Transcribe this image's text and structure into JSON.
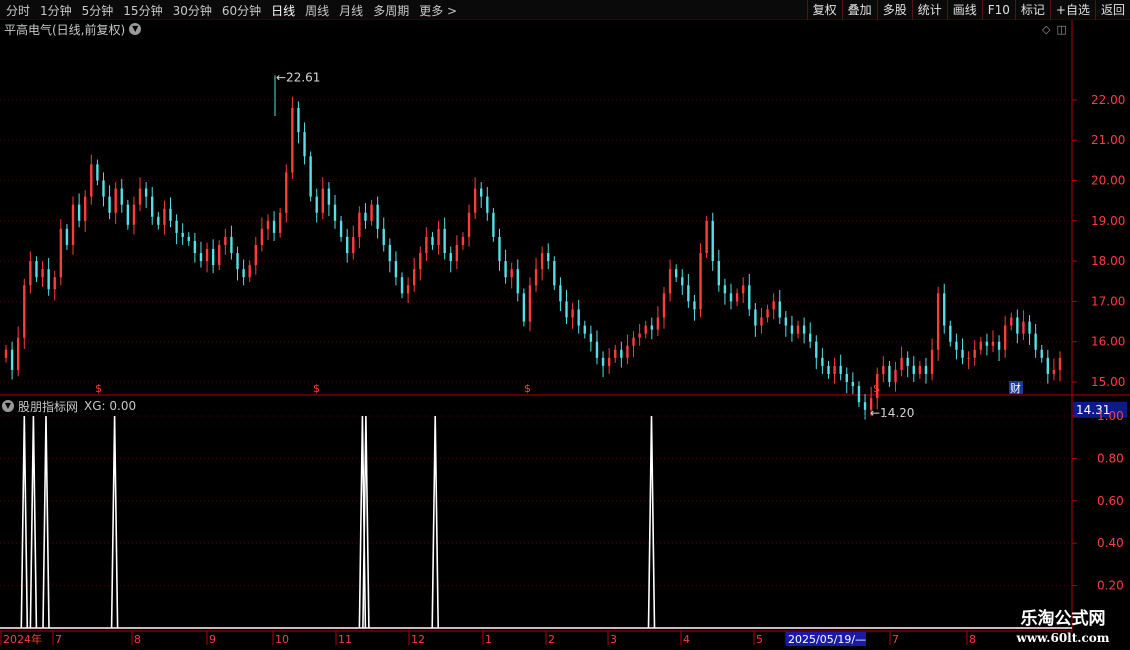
{
  "toolbar": {
    "periods": [
      "分时",
      "1分钟",
      "5分钟",
      "15分钟",
      "30分钟",
      "60分钟",
      "日线",
      "周线",
      "月线",
      "多周期",
      "更多 >"
    ],
    "active_period": "日线",
    "right_buttons": [
      "复权",
      "叠加",
      "多股",
      "统计",
      "画线",
      "F10",
      "标记",
      "+自选",
      "返回"
    ]
  },
  "price_panel": {
    "title": "平高电气(日线,前复权)",
    "high_label": "22.61",
    "low_label": "14.20",
    "current_price_label": "14.31",
    "y_ticks": [
      "22.00",
      "21.00",
      "20.00",
      "19.00",
      "18.00",
      "17.00",
      "16.00",
      "15.00"
    ],
    "dividend_marker": "$",
    "finance_marker": "财"
  },
  "indicator_panel": {
    "name": "股朋指标网",
    "value_text": "XG: 0.00",
    "y_ticks": [
      "1.00",
      "0.80",
      "0.60",
      "0.40",
      "0.20"
    ]
  },
  "time_axis": {
    "labels": [
      "2024年",
      "7",
      "8",
      "9",
      "10",
      "11",
      "12",
      "1",
      "2",
      "3",
      "4",
      "5",
      "2025/05/19/—",
      "7",
      "8"
    ],
    "highlight": "2025/05/19/—"
  },
  "watermark": {
    "line1": "乐淘公式网",
    "line2": "www.60lt.com"
  },
  "colors": {
    "up": "#ff3c3c",
    "down": "#54e0e6",
    "axis": "#b40000",
    "grid": "#5a0000",
    "signal": "#ffffff",
    "price_box": "#0c1a8a",
    "date_box": "#1a1aa8"
  },
  "chart_data": [
    {
      "type": "candlestick",
      "title": "平高电气(日线,前复权)",
      "ylim": [
        14.0,
        22.8
      ],
      "y_ticks": [
        15,
        16,
        17,
        18,
        19,
        20,
        21,
        22
      ],
      "x_range": [
        "2024-06",
        "2025-08"
      ],
      "key_points": [
        {
          "label": "start",
          "approx_close": 15.4
        },
        {
          "label": "2024-07 high",
          "approx_close": 20.4
        },
        {
          "label": "2024-10 peak",
          "value": 22.61
        },
        {
          "label": "2024-12 high",
          "approx_close": 19.8
        },
        {
          "label": "2025-02 low",
          "approx_close": 16.4
        },
        {
          "label": "2025-03 low",
          "approx_close": 15.5
        },
        {
          "label": "2025-04 high",
          "approx_close": 19.0
        },
        {
          "label": "2025-06 trough",
          "value": 14.2
        },
        {
          "label": "2025-07 high",
          "approx_close": 17.3
        },
        {
          "label": "last",
          "value": 14.31
        }
      ],
      "closes": [
        15.8,
        15.3,
        16.1,
        17.4,
        18.0,
        17.6,
        17.8,
        17.3,
        17.6,
        18.8,
        18.4,
        19.4,
        19.0,
        19.6,
        20.4,
        20.0,
        19.6,
        19.2,
        19.8,
        19.4,
        18.9,
        19.4,
        19.8,
        19.6,
        19.1,
        18.9,
        19.3,
        19.0,
        18.7,
        18.6,
        18.5,
        18.2,
        18.0,
        18.3,
        17.9,
        18.4,
        18.6,
        18.2,
        17.8,
        17.6,
        17.9,
        18.4,
        18.8,
        19.0,
        18.7,
        19.2,
        20.2,
        21.8,
        21.2,
        20.6,
        19.6,
        19.2,
        19.8,
        19.4,
        19.0,
        18.6,
        18.2,
        18.6,
        19.2,
        19.0,
        19.4,
        18.8,
        18.4,
        18.0,
        17.6,
        17.2,
        17.4,
        17.8,
        18.2,
        18.6,
        18.4,
        18.8,
        18.2,
        18.0,
        18.4,
        18.6,
        19.2,
        19.8,
        19.6,
        19.2,
        18.6,
        18.0,
        17.6,
        17.8,
        17.2,
        16.5,
        17.4,
        17.8,
        18.2,
        18.0,
        17.4,
        17.0,
        16.6,
        16.8,
        16.4,
        16.2,
        16.0,
        15.6,
        15.4,
        15.6,
        15.8,
        15.6,
        15.9,
        16.1,
        16.2,
        16.4,
        16.3,
        16.6,
        17.2,
        17.8,
        17.6,
        17.4,
        17.0,
        16.8,
        18.2,
        19.0,
        18.0,
        17.4,
        17.2,
        17.0,
        17.2,
        17.4,
        16.8,
        16.4,
        16.6,
        16.8,
        17.0,
        16.6,
        16.4,
        16.2,
        16.4,
        16.2,
        16.0,
        15.6,
        15.4,
        15.2,
        15.4,
        15.2,
        15.0,
        14.9,
        14.5,
        14.31,
        14.6,
        15.2,
        15.4,
        15.0,
        15.3,
        15.6,
        15.4,
        15.2,
        15.4,
        15.2,
        15.8,
        17.2,
        16.4,
        16.0,
        15.8,
        15.6,
        15.6,
        15.8,
        16.0,
        15.9,
        16.0,
        15.8,
        16.4,
        16.6,
        16.2,
        16.5,
        16.2,
        15.8,
        15.6,
        15.2,
        15.3,
        15.6
      ]
    },
    {
      "type": "line",
      "title": "股朋指标网",
      "series": [
        {
          "name": "XG",
          "values": []
        }
      ],
      "ylim": [
        0,
        1.05
      ],
      "y_ticks": [
        0.2,
        0.4,
        0.6,
        0.8,
        1.0
      ],
      "spike_positions": [
        0.09,
        0.22,
        0.4,
        1.38,
        4.92,
        4.97,
        5.96,
        9.05
      ]
    }
  ]
}
